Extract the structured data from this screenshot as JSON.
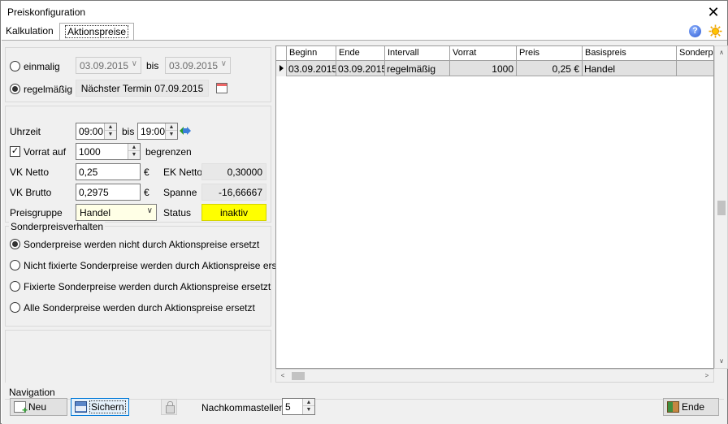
{
  "window": {
    "title": "Preiskonfiguration",
    "close_glyph": "✕"
  },
  "tabs": [
    {
      "label": "Kalkulation",
      "active": false
    },
    {
      "label": "Aktionspreise",
      "active": true
    }
  ],
  "icons": {
    "help": "help-icon",
    "settings": "sun-icon",
    "help_glyph": "?"
  },
  "schedule": {
    "einmalig_label": "einmalig",
    "from_date": "03.09.2015",
    "bis_label": "bis",
    "to_date": "03.09.2015",
    "regelmaessig_label": "regelmäßig",
    "next_term": "Nächster Termin 07.09.2015",
    "selected": "regelmäßig"
  },
  "details": {
    "uhrzeit_label": "Uhrzeit",
    "time_from": "09:00",
    "bis_label": "bis",
    "time_to": "19:00",
    "vorrat_label": "Vorrat auf",
    "vorrat_checked": true,
    "vorrat_value": "1000",
    "begrenzen_label": "begrenzen",
    "vk_netto_label": "VK Netto",
    "vk_netto_value": "0,25",
    "currency": "€",
    "ek_netto_label": "EK Netto",
    "ek_netto_value": "0,30000",
    "vk_brutto_label": "VK Brutto",
    "vk_brutto_value": "0,2975",
    "spanne_label": "Spanne",
    "spanne_value": "-16,66667",
    "preisgruppe_label": "Preisgruppe",
    "preisgruppe_value": "Handel",
    "status_label": "Status",
    "status_value": "inaktiv",
    "status_color": "#ffff00"
  },
  "sonderpreis": {
    "title": "Sonderpreisverhalten",
    "options": [
      "Sonderpreise werden nicht durch Aktionspreise ersetzt",
      "Nicht fixierte Sonderpreise werden durch Aktionspreise ersetzt",
      "Fixierte Sonderpreise werden durch Aktionspreise ersetzt",
      "Alle Sonderpreise werden durch Aktionspreise ersetzt"
    ],
    "selected_index": 0
  },
  "grid": {
    "columns": [
      "Beginn",
      "Ende",
      "Intervall",
      "Vorrat",
      "Preis",
      "Basispreis",
      "Sonderp"
    ],
    "rows": [
      [
        "03.09.2015",
        "03.09.2015",
        "regelmäßig",
        "1000",
        "0,25 €",
        "Handel",
        ""
      ]
    ]
  },
  "navigation": {
    "title": "Navigation",
    "new_label": "Neu",
    "save_label": "Sichern",
    "nachkomma_label": "Nachkommastellen",
    "nachkomma_value": "5",
    "exit_label": "Ende"
  }
}
